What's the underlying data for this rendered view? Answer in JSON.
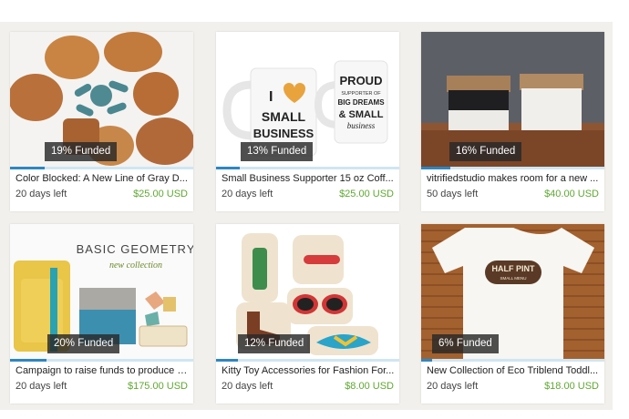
{
  "campaigns": [
    {
      "funded": "19% Funded",
      "progress": 0.19,
      "title": "Color Blocked: A New Line of Gray D...",
      "days_left": "20 days left",
      "price": "$25.00 USD"
    },
    {
      "funded": "13% Funded",
      "progress": 0.13,
      "title": "Small Business Supporter 15 oz Coff...",
      "days_left": "20 days left",
      "price": "$25.00 USD",
      "image_text": [
        "I",
        "SMALL",
        "BUSINESS",
        "PROUD",
        "SUPPORTER OF",
        "BIG DREAMS",
        "& SMALL",
        "business"
      ]
    },
    {
      "funded": "16% Funded",
      "progress": 0.16,
      "title": "vitrifiedstudio makes room for a new ...",
      "days_left": "50 days left",
      "price": "$40.00 USD"
    },
    {
      "funded": "20% Funded",
      "progress": 0.2,
      "title": "Campaign to raise funds to produce a...",
      "days_left": "20 days left",
      "price": "$175.00 USD",
      "image_text": [
        "BASIC GEOMETRY",
        "new collection"
      ]
    },
    {
      "funded": "12% Funded",
      "progress": 0.12,
      "title": "Kitty Toy Accessories for Fashion For...",
      "days_left": "20 days left",
      "price": "$8.00 USD"
    },
    {
      "funded": "6% Funded",
      "progress": 0.06,
      "title": "New Collection of Eco Triblend Toddl...",
      "days_left": "20 days left",
      "price": "$18.00 USD",
      "image_text": [
        "HALF PINT",
        "SMALL MENU"
      ]
    }
  ],
  "colors": {
    "progress_fill": "#2e86c1",
    "progress_track": "#cfe6f3",
    "price_green": "#5fa832"
  }
}
